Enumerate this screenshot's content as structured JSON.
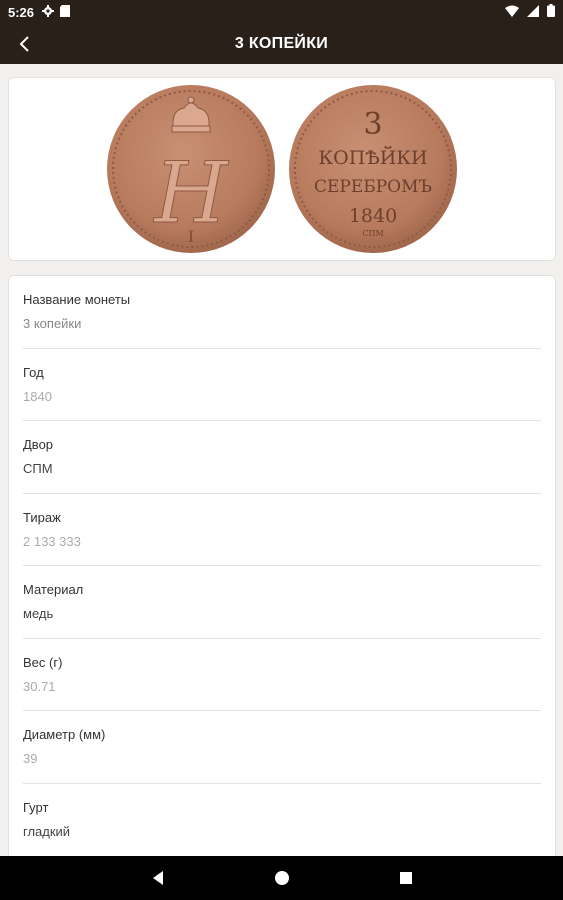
{
  "status": {
    "time": "5:26"
  },
  "appbar": {
    "title": "3 КОПЕЙКИ"
  },
  "coin": {
    "obverse_monogram": "Н",
    "obverse_numeral": "I",
    "reverse_line1": "3",
    "reverse_line2": "КОПѢЙКИ",
    "reverse_line3": "СЕРЕБРОМЪ",
    "reverse_year": "1840",
    "reverse_mint": "СПМ"
  },
  "fields": [
    {
      "label": "Название монеты",
      "value": "3 копейки"
    },
    {
      "label": "Год",
      "value": "1840"
    },
    {
      "label": "Двор",
      "value": "СПМ"
    },
    {
      "label": "Тираж",
      "value": "2 133 333"
    },
    {
      "label": "Материал",
      "value": "медь"
    },
    {
      "label": "Вес (г)",
      "value": "30.71"
    },
    {
      "label": "Диаметр (мм)",
      "value": "39"
    },
    {
      "label": "Гурт",
      "value": "гладкий"
    }
  ],
  "colors": {
    "bar": "#2a201a",
    "copper": "#b77a5d"
  },
  "icons": {
    "status_left": [
      "gear-icon",
      "sd-card-icon"
    ],
    "status_right": [
      "wifi-icon",
      "signal-icon",
      "battery-icon"
    ],
    "nav": [
      "back-triangle-icon",
      "home-circle-icon",
      "recents-square-icon"
    ]
  }
}
